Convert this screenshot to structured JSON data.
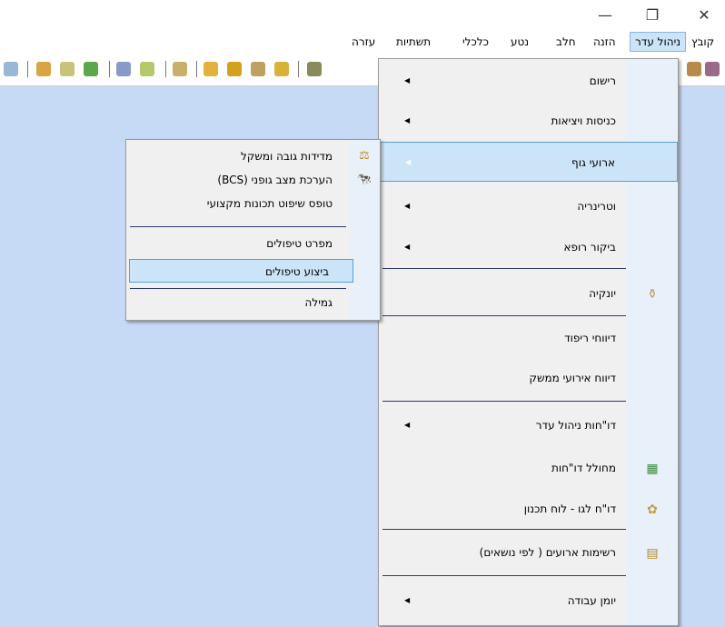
{
  "window": {
    "minimize_glyph": "—",
    "restore_glyph": "❐",
    "close_glyph": "✕"
  },
  "menubar": {
    "items": [
      {
        "label": "קובץ"
      },
      {
        "label": "ניהול עדר"
      },
      {
        "label": "הזנה"
      },
      {
        "label": "חלב"
      },
      {
        "label": "נטע"
      },
      {
        "label": "כלכלי"
      },
      {
        "label": "תשתיות"
      },
      {
        "label": "עזרה"
      }
    ]
  },
  "main_menu": {
    "items": [
      {
        "label": "רישום",
        "has_submenu": true
      },
      {
        "label": "כניסות ויציאות",
        "has_submenu": true
      },
      {
        "label": "ארועי גוף",
        "has_submenu": true,
        "highlighted": true
      },
      {
        "label": "וטרינריה",
        "has_submenu": true
      },
      {
        "label": "ביקור רופא",
        "has_submenu": true
      },
      {
        "label": "יונקיה",
        "icon": "baby-bottle-icon"
      },
      {
        "label": "דיווחי ריפוד"
      },
      {
        "label": "דיווח אירועי ממשק"
      },
      {
        "label": "דו\"חות ניהול עדר",
        "has_submenu": true
      },
      {
        "label": "מחולל דו\"חות",
        "icon": "report-generator-icon"
      },
      {
        "label": "דו\"ח לגו - לוח תכנון",
        "icon": "lego-planning-icon"
      },
      {
        "label": "רשימות ארועים ( לפי נושאים)",
        "icon": "event-lists-icon"
      },
      {
        "label": "יומן עבודה",
        "has_submenu": true
      }
    ]
  },
  "sub_menu": {
    "items": [
      {
        "label": "מדידות גובה ומשקל",
        "icon": "scale-icon"
      },
      {
        "label": "הערכת מצב גופני (BCS)",
        "icon": "cow-icon"
      },
      {
        "label": "טופס שיפוט תכונות מקצועי"
      },
      {
        "label": "מפרט טיפולים"
      },
      {
        "label": "ביצוע טיפולים",
        "highlighted": true
      },
      {
        "label": "גמילה"
      }
    ]
  },
  "colors": {
    "workspace": "#c6d9f5",
    "highlight": "#cce4f7",
    "highlight_border": "#5a9fd4"
  }
}
